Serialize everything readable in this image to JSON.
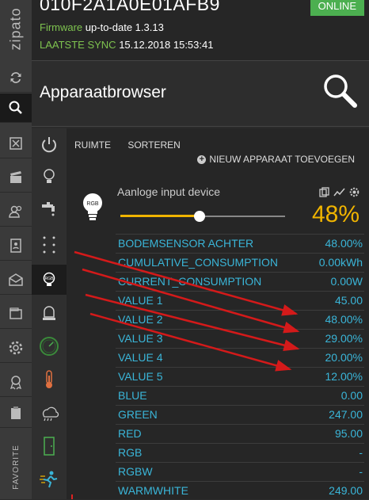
{
  "app": {
    "logo_text": "zipato"
  },
  "header": {
    "device_id": "010F2A1A0E01AFB9",
    "status": "ONLINE",
    "firmware_label": "Firmware",
    "firmware_value": "up-to-date 1.3.13",
    "sync_label": "LAATSTE SYNC",
    "sync_value": "15.12.2018 15:53:41"
  },
  "titlebar": {
    "title": "Apparaatbrowser"
  },
  "sidebar": {
    "items": [
      {
        "name": "refresh-icon"
      },
      {
        "name": "search-icon"
      },
      {
        "name": "scenes-icon"
      },
      {
        "name": "clapper-icon"
      },
      {
        "name": "users-icon"
      },
      {
        "name": "contacts-icon"
      },
      {
        "name": "mail-icon"
      },
      {
        "name": "wallet-icon"
      },
      {
        "name": "gear-icon"
      },
      {
        "name": "badge-icon"
      },
      {
        "name": "clipboard-icon"
      }
    ],
    "favorite_label": "FAVORITE"
  },
  "categories": [
    {
      "name": "power-icon"
    },
    {
      "name": "bulb-icon"
    },
    {
      "name": "faucet-icon"
    },
    {
      "name": "sensor-dots-icon"
    },
    {
      "name": "rgb-bulb-icon"
    },
    {
      "name": "alarm-light-icon"
    },
    {
      "name": "gauge-icon"
    },
    {
      "name": "thermometer-icon"
    },
    {
      "name": "weather-icon"
    },
    {
      "name": "door-icon"
    },
    {
      "name": "motion-icon"
    }
  ],
  "toolbar": {
    "room": "RUIMTE",
    "sort": "SORTEREN",
    "add_device": "NIEUW APPARAAT TOEVOEGEN"
  },
  "device": {
    "name": "Aanloge input device",
    "icon_label": "RGB",
    "level_percent": "48%",
    "level_fraction": 0.48,
    "attributes": [
      {
        "label": "BODEMSENSOR ACHTER",
        "value": "48.00%"
      },
      {
        "label": "CUMULATIVE_CONSUMPTION",
        "value": "0.00kWh"
      },
      {
        "label": "CURRENT_CONSUMPTION",
        "value": "0.00W"
      },
      {
        "label": "VALUE 1",
        "value": "45.00"
      },
      {
        "label": "VALUE 2",
        "value": "48.00%"
      },
      {
        "label": "VALUE 3",
        "value": "29.00%"
      },
      {
        "label": "VALUE 4",
        "value": "20.00%"
      },
      {
        "label": "VALUE 5",
        "value": "12.00%"
      },
      {
        "label": "BLUE",
        "value": "0.00"
      },
      {
        "label": "GREEN",
        "value": "247.00"
      },
      {
        "label": "RED",
        "value": "95.00"
      },
      {
        "label": "RGB",
        "value": "-"
      },
      {
        "label": "RGBW",
        "value": "-"
      },
      {
        "label": "WARMWHITE",
        "value": "249.00"
      }
    ]
  },
  "colors": {
    "accent": "#f0b400",
    "online": "#4caf50",
    "attribute_text": "#3ab5d8",
    "annotation_arrow": "#d41a1a"
  }
}
